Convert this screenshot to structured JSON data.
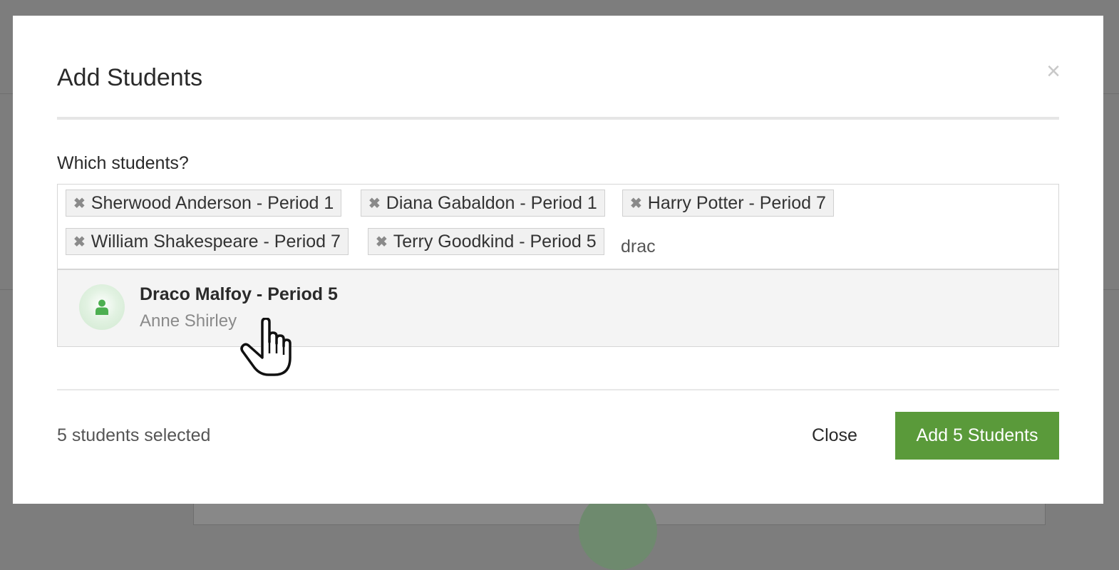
{
  "modal": {
    "title": "Add Students",
    "close_icon": "close-icon",
    "field_label": "Which students?",
    "chips": [
      {
        "label": "Sherwood Anderson - Period 1"
      },
      {
        "label": "Diana Gabaldon - Period 1"
      },
      {
        "label": "Harry Potter - Period 7"
      },
      {
        "label": "William Shakespeare - Period 7"
      },
      {
        "label": "Terry Goodkind - Period 5"
      }
    ],
    "search": {
      "value": "drac"
    },
    "result": {
      "name": "Draco Malfoy - Period 5",
      "subtitle": "Anne Shirley",
      "icon": "user-icon"
    },
    "footer": {
      "selected_count": "5 students selected",
      "close_label": "Close",
      "add_label": "Add 5 Students"
    }
  },
  "colors": {
    "overlay": "#7d7d7d",
    "primary_button": "#5a9a3a",
    "avatar_icon": "#4caf50"
  }
}
